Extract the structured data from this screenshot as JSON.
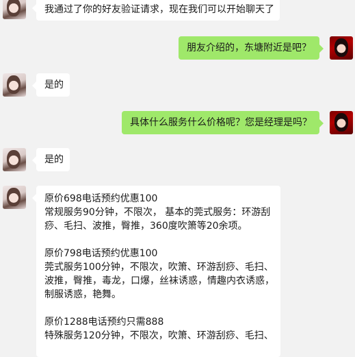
{
  "messages": [
    {
      "side": "left",
      "text": "我通过了你的好友验证请求，现在我们可以开始聊天了"
    },
    {
      "side": "right",
      "text": "朋友介绍的，东塘附近是吧？"
    },
    {
      "side": "left",
      "text": "是的"
    },
    {
      "side": "right",
      "text": "具体什么服务什么价格呢？您是经理是吗？"
    },
    {
      "side": "left",
      "text": "是的"
    }
  ],
  "service_message": {
    "lines": [
      "原价698电话预约优惠100",
      "常规服务90分钟，不限次， 基本的莞式服务：环游刮",
      "痧、毛扫、波推，臀推，360度吹箫等20余项。",
      "",
      "原价798电话预约优惠100",
      "莞式服务100分钟，不限次，吹箫、环游刮痧、毛扫、",
      "波推，臀推，毒龙，口爆，丝袜诱惑，情趣内衣诱惑，",
      "制服诱惑，艳舞。",
      "",
      "原价1288电话预约只需888",
      "特殊服务120分钟，不限次，吹箫、环游刮痧、毛扫、"
    ]
  }
}
